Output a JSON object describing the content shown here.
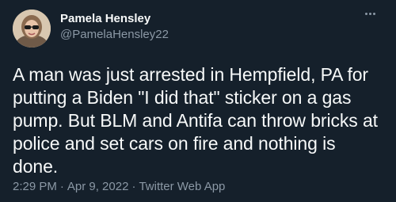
{
  "author": {
    "display_name": "Pamela Hensley",
    "handle": "@PamelaHensley22",
    "avatar_icon": "profile-photo"
  },
  "tweet": {
    "text": "A man was just arrested in Hempfield, PA for putting a Biden \"I did that\" sticker on a gas pump. But BLM and Antifa can throw bricks at police and set cars on fire and nothing is done.",
    "time": "2:29 PM",
    "date": "Apr 9, 2022",
    "source": "Twitter Web App",
    "separator": "·"
  },
  "more_icon": "more-horizontal-icon",
  "colors": {
    "background": "#15202b",
    "primary_text": "#f7f9f9",
    "secondary_text": "#8b98a5"
  }
}
